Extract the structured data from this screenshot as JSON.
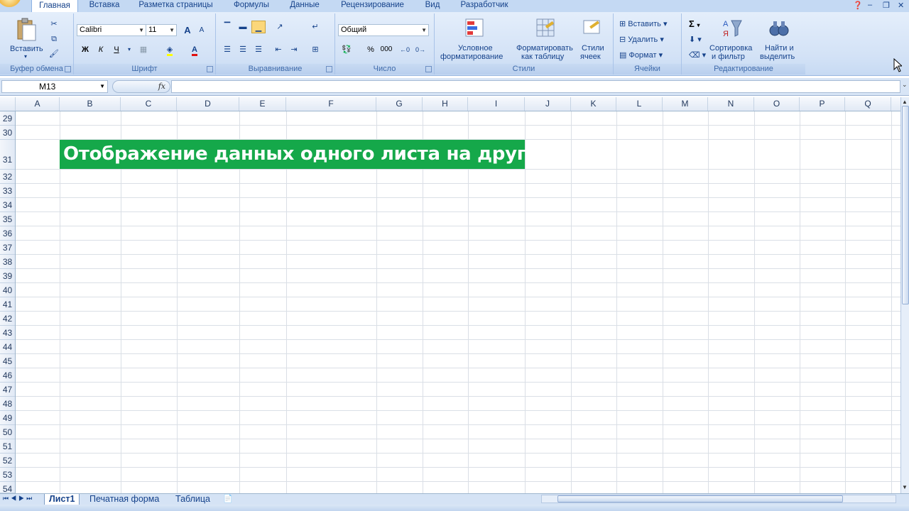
{
  "ribbon_tabs": [
    {
      "label": "Главная",
      "active": true
    },
    {
      "label": "Вставка"
    },
    {
      "label": "Разметка страницы"
    },
    {
      "label": "Формулы"
    },
    {
      "label": "Данные"
    },
    {
      "label": "Рецензирование"
    },
    {
      "label": "Вид"
    },
    {
      "label": "Разработчик"
    }
  ],
  "clipboard": {
    "paste": "Вставить",
    "label": "Буфер обмена"
  },
  "font": {
    "name": "Calibri",
    "size": "11",
    "bold": "Ж",
    "italic": "К",
    "underline": "Ч",
    "grow": "A",
    "shrink": "A",
    "color": "A",
    "label": "Шрифт"
  },
  "alignment": {
    "label": "Выравнивание"
  },
  "number": {
    "format": "Общий",
    "percent": "%",
    "thousands": "000",
    "label": "Число"
  },
  "styles": {
    "conditional_line1": "Условное",
    "conditional_line2": "форматирование",
    "astable_line1": "Форматировать",
    "astable_line2": "как таблицу",
    "cellstyles_line1": "Стили",
    "cellstyles_line2": "ячеек",
    "label": "Стили"
  },
  "cells": {
    "insert": "Вставить",
    "delete": "Удалить",
    "format": "Формат",
    "label": "Ячейки"
  },
  "editing": {
    "sum": "Σ",
    "sort_line1": "Сортировка",
    "sort_line2": "и фильтр",
    "find_line1": "Найти и",
    "find_line2": "выделить",
    "label": "Редактирование"
  },
  "formula_bar": {
    "name_box": "M13",
    "fx": "fx",
    "value": ""
  },
  "columns": [
    "A",
    "B",
    "C",
    "D",
    "E",
    "F",
    "G",
    "H",
    "I",
    "J",
    "K",
    "L",
    "M",
    "N",
    "O",
    "P",
    "Q"
  ],
  "rows": [
    "29",
    "30",
    "31",
    "32",
    "33",
    "34",
    "35",
    "36",
    "37",
    "38",
    "39",
    "40",
    "41",
    "42",
    "43",
    "44",
    "45",
    "46",
    "47",
    "48",
    "49",
    "50",
    "51",
    "52",
    "53",
    "54"
  ],
  "banner": {
    "text": "Отображение данных одного листа на другом",
    "color": "#15a84a"
  },
  "sheet_tabs": [
    {
      "label": "Лист1",
      "active": true
    },
    {
      "label": "Печатная форма"
    },
    {
      "label": "Таблица"
    }
  ],
  "colors": {
    "ribbon_bg": "#d3e2f6",
    "text": "#15428b",
    "grid": "#dadfe6"
  }
}
